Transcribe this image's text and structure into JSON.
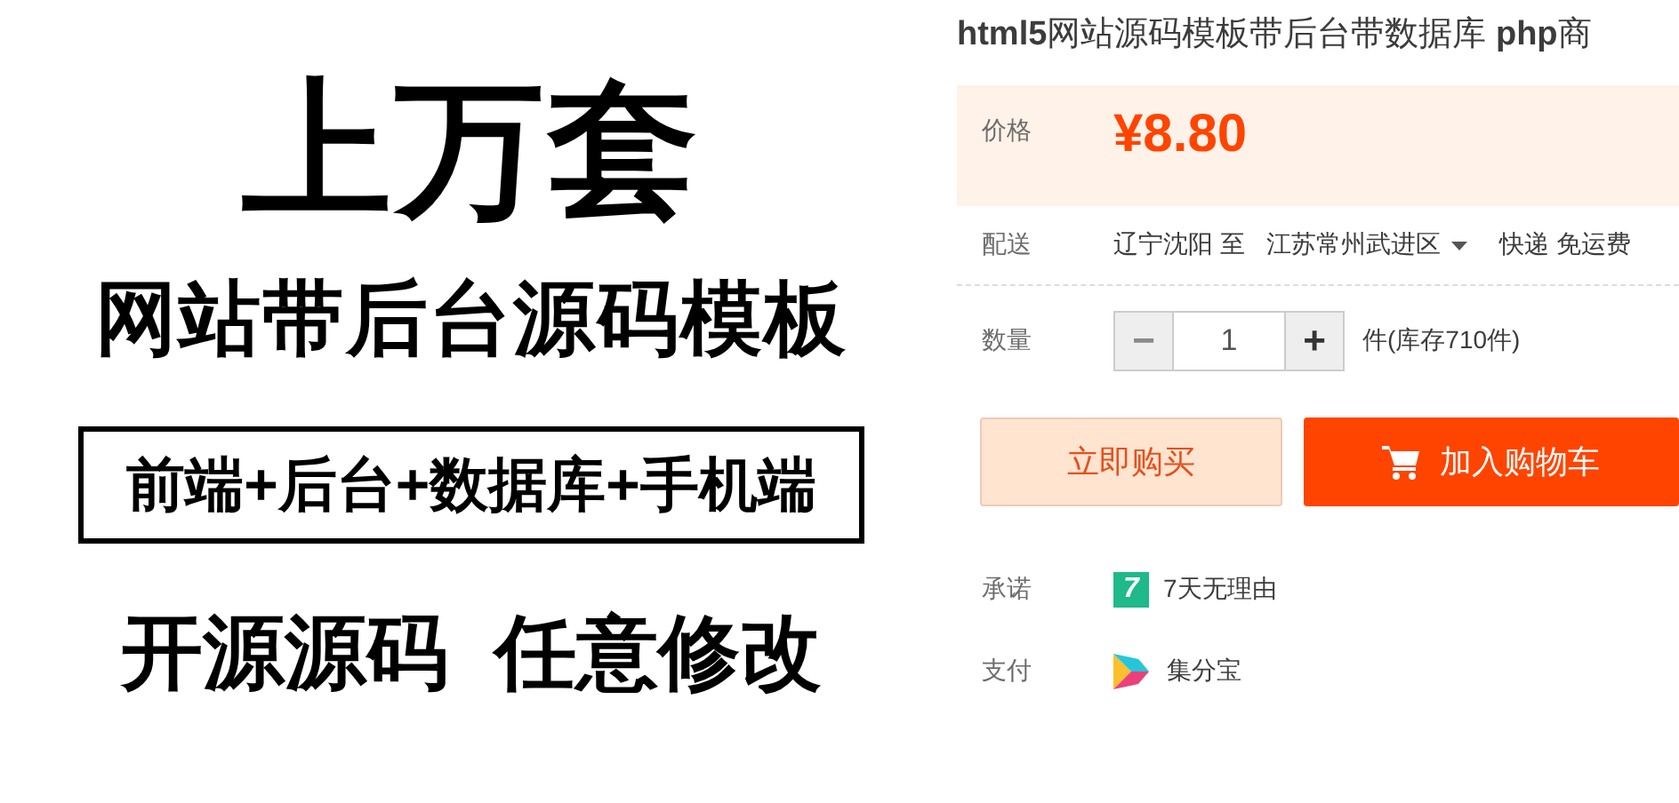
{
  "product_image": {
    "headline": "上万套",
    "subtitle": "网站带后台源码模板",
    "boxed_line": "前端+后台+数据库+手机端",
    "lines": [
      "开源源码  任意修改"
    ]
  },
  "title": "**html5**网站源码模板带后台带数据库 **php**商",
  "price": {
    "label": "价格",
    "value": "¥8.80"
  },
  "delivery": {
    "label": "配送",
    "from": "辽宁沈阳 至",
    "to": "江苏常州武进区",
    "shipping": "快递 免运费"
  },
  "quantity": {
    "label": "数量",
    "minus": "−",
    "value": "1",
    "plus": "+",
    "stock": "件(库存710件)",
    "minus_disabled": true
  },
  "buttons": [
    {
      "kind": "buy",
      "label": "立即购买"
    },
    {
      "kind": "cart",
      "label": "加入购物车"
    }
  ],
  "services": [
    {
      "kind": "seven",
      "label": "承诺",
      "value": "7天无理由",
      "icon_text": "7"
    },
    {
      "kind": "pay",
      "label": "支付",
      "value": "集分宝"
    }
  ]
}
